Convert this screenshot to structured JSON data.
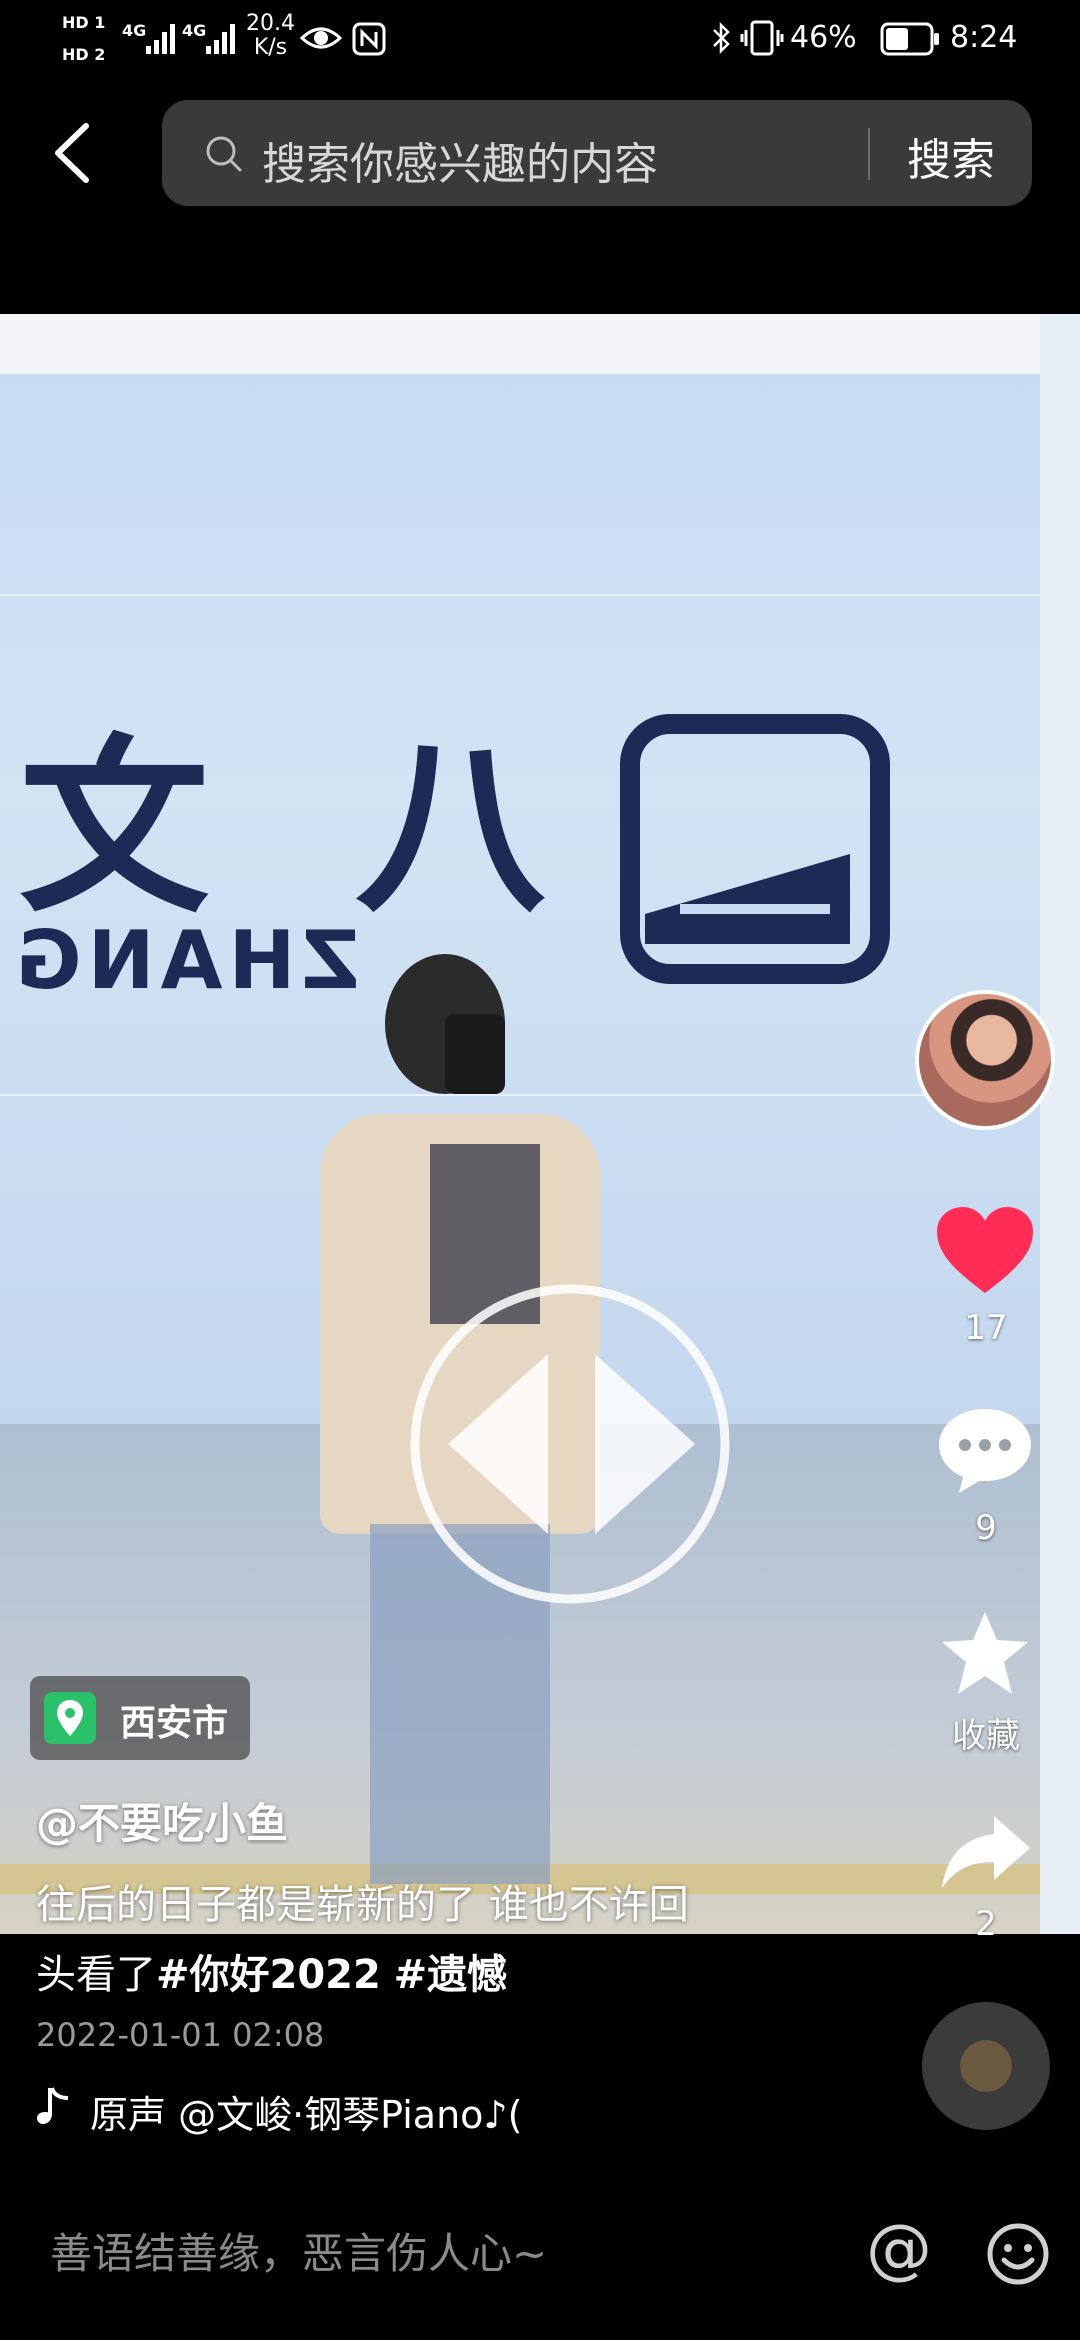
{
  "status_bar": {
    "hd1": "HD 1",
    "hd2": "HD 2",
    "net1": "4G",
    "net2": "4G",
    "speed_value": "20.4",
    "speed_unit": "K/s",
    "battery": "46%",
    "time": "8:24"
  },
  "search": {
    "placeholder": "搜索你感兴趣的内容",
    "button": "搜索"
  },
  "video": {
    "station_chars": "八 文",
    "station_pinyin": "ZHANG"
  },
  "actions": {
    "likes": "17",
    "comments": "9",
    "favorite_label": "收藏",
    "shares": "2"
  },
  "post": {
    "location": "西安市",
    "author": "@不要吃小鱼",
    "desc_line1": "往后的日子都是崭新的了 谁也不许回",
    "desc_line2_prefix": "头看了",
    "tag1": "#你好2022",
    "tag2": "#遗憾",
    "date": "2022-01-01 02:08",
    "music": "原声    @文峻·钢琴Piano♪("
  },
  "comment_bar": {
    "placeholder": "善语结善缘，恶言伤人心~",
    "at_label": "@"
  },
  "colors": {
    "like_red": "#ff2d55",
    "location_green": "#2bc06a"
  }
}
